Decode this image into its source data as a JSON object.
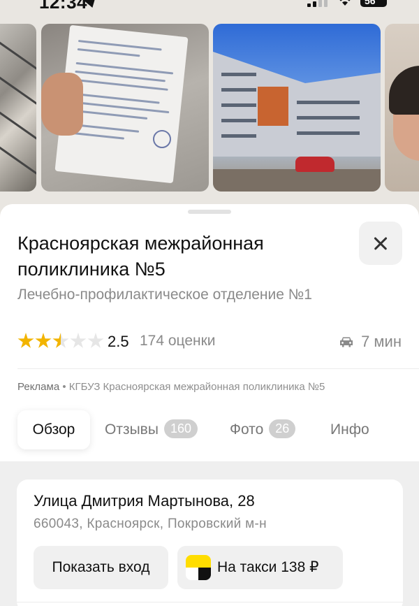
{
  "status_bar": {
    "time": "12:34",
    "battery": "56"
  },
  "header": {
    "title": "Красноярская межрайонная поликлиника №5",
    "subtitle": "Лечебно-профилактическое отделение №1",
    "rating_value": "2.5",
    "rating_stars": 2.5,
    "rating_count": "174 оценки",
    "drive_time": "7 мин"
  },
  "ad": {
    "label": "Реклама",
    "advertiser": "КГБУЗ Красноярская межрайонная поликлиника №5"
  },
  "tabs": [
    {
      "label": "Обзор",
      "badge": ""
    },
    {
      "label": "Отзывы",
      "badge": "160"
    },
    {
      "label": "Фото",
      "badge": "26"
    },
    {
      "label": "Инфо",
      "badge": ""
    }
  ],
  "address": {
    "street": "Улица Дмитрия Мартынова, 28",
    "locality": "660043, Красноярск, Покровский м-н",
    "show_entrance_label": "Показать вход",
    "taxi_label": "На такси 138 ₽"
  },
  "colors": {
    "star": "#f2b400",
    "taxi_yellow": "#ffdd00"
  },
  "icons": [
    "location-arrow-icon",
    "signal-icon",
    "wifi-icon",
    "battery-icon",
    "close-icon",
    "star-icon",
    "car-icon",
    "yandex-taxi-icon"
  ]
}
